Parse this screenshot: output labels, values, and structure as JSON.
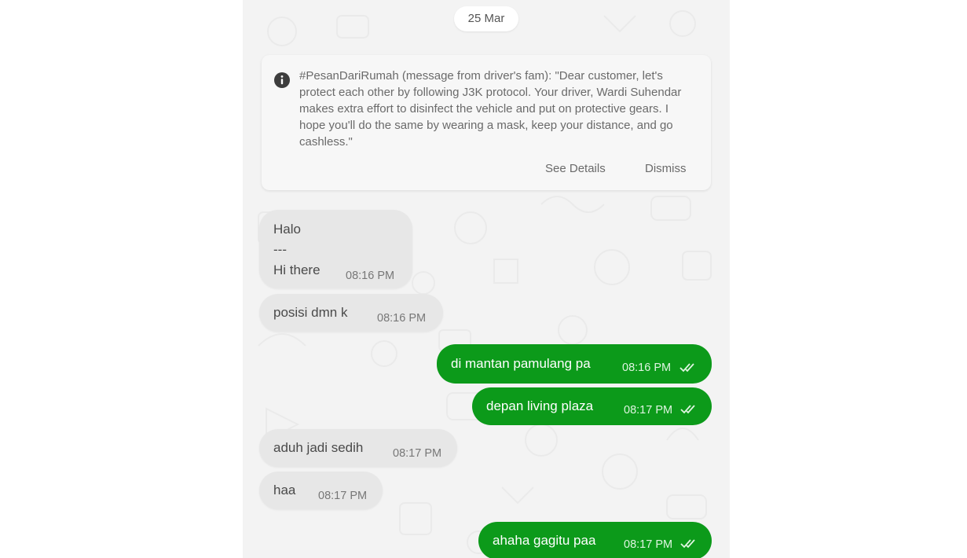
{
  "chat": {
    "date": "25 Mar",
    "notice": {
      "icon": "info-icon",
      "text": "#PesanDariRumah (message from driver's fam): \"Dear customer, let's protect each other by following J3K protocol. Your driver, Wardi Suhendar makes extra effort to disinfect the vehicle and put on protective gears. I hope you'll do the same by wearing a mask, keep your distance, and go cashless.\"",
      "see_details": "See Details",
      "dismiss": "Dismiss"
    },
    "messages": [
      {
        "direction": "incoming",
        "lines": [
          "Halo",
          "---",
          "Hi there"
        ],
        "time": "08:16 PM"
      },
      {
        "direction": "incoming",
        "text": "posisi dmn k",
        "time": "08:16 PM"
      },
      {
        "direction": "outgoing",
        "text": "di mantan pamulang pa",
        "time": "08:16 PM",
        "status": "read-double-check-icon"
      },
      {
        "direction": "outgoing",
        "text": "depan living plaza",
        "time": "08:17 PM",
        "status": "read-double-check-icon"
      },
      {
        "direction": "incoming",
        "text": "aduh jadi sedih",
        "time": "08:17 PM"
      },
      {
        "direction": "incoming",
        "text": "haa",
        "time": "08:17 PM"
      },
      {
        "direction": "outgoing",
        "text": "ahaha gagitu paa",
        "time": "08:17 PM",
        "status": "read-double-check-icon"
      }
    ]
  },
  "colors": {
    "outgoing_bubble": "#0c9a1a",
    "incoming_bubble": "#e7e7e7",
    "chat_background": "#f3f3f3"
  }
}
